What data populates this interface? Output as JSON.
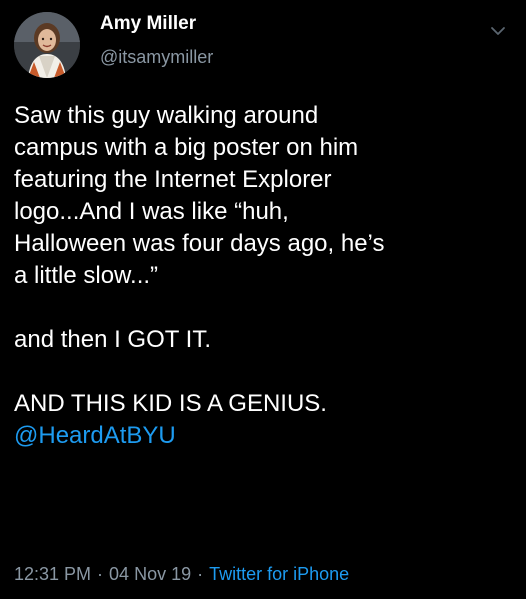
{
  "author": {
    "display_name": "Amy Miller",
    "handle": "@itsamymiller",
    "avatar_icon": "profile-photo"
  },
  "tweet": {
    "lines": [
      "Saw this guy walking around",
      "campus with a big poster on him",
      "featuring the Internet Explorer",
      "logo...And I was like “huh,",
      "Halloween was four days ago, he’s",
      "a little slow...”"
    ],
    "line2": "and then I GOT IT.",
    "line3": "AND THIS KID IS A GENIUS.",
    "mention": "@HeardAtBYU"
  },
  "meta": {
    "time": "12:31 PM",
    "separator": "·",
    "date": "04 Nov 19",
    "source": "Twitter for iPhone"
  },
  "colors": {
    "background": "#000000",
    "text": "#ffffff",
    "muted": "#8a97a3",
    "link": "#1d9bf0"
  },
  "icons": {
    "menu": "chevron-down-icon"
  }
}
